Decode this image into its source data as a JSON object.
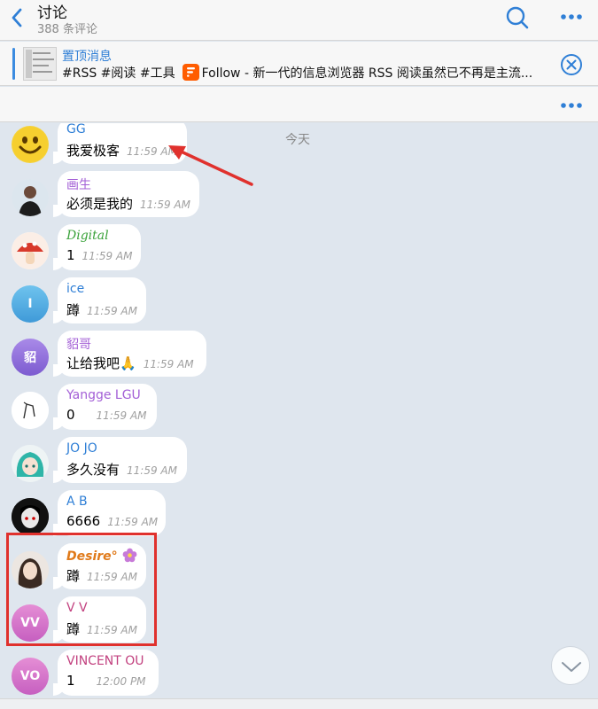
{
  "header": {
    "title": "讨论",
    "subtitle": "388 条评论",
    "icons": [
      "back-icon",
      "search-icon",
      "more-icon"
    ]
  },
  "pinned": {
    "label": "置顶消息",
    "tags": "#RSS #阅读 #工具",
    "follow_text": "Follow - 新一代的信息浏览器  RSS 阅读虽然已不再是主流...",
    "accent": "#2f7fd6"
  },
  "chat": {
    "date": "今天",
    "messages": [
      {
        "sender": "GG",
        "text": "我爱极客",
        "time": "11:59 AM",
        "sender_color": "#2f7fd6"
      },
      {
        "sender": "画生",
        "text": "必须是我的",
        "time": "11:59 AM",
        "sender_color": "#a35fd6"
      },
      {
        "sender": "Digital",
        "text": "1",
        "time": "11:59 AM",
        "sender_color": "#3aa23a"
      },
      {
        "sender": "ice",
        "text": "蹲",
        "time": "11:59 AM",
        "sender_color": "#2f7fd6",
        "avatar_letter": "I"
      },
      {
        "sender": "貂哥",
        "text": "让给我吧🙏",
        "time": "11:59 AM",
        "sender_color": "#a35fd6",
        "avatar_letter": "貂"
      },
      {
        "sender": "Yangge LGU",
        "text": "0",
        "time": "11:59 AM",
        "sender_color": "#a35fd6"
      },
      {
        "sender": "JO JO",
        "text": "多久没有",
        "time": "11:59 AM",
        "sender_color": "#2f7fd6"
      },
      {
        "sender": "A B",
        "text": "6666",
        "time": "11:59 AM",
        "sender_color": "#2f7fd6"
      },
      {
        "sender": "Desire°",
        "text": "蹲",
        "time": "11:59 AM",
        "sender_color": "#e07a1a"
      },
      {
        "sender": "V V",
        "text": "蹲",
        "time": "11:59 AM",
        "sender_color": "#c2417f",
        "avatar_letter": "VV"
      },
      {
        "sender": "VINCENT OU",
        "text": "1",
        "time": "12:00 PM",
        "sender_color": "#c2417f",
        "avatar_letter": "VO"
      }
    ]
  },
  "colors": {
    "annotation_red": "#e0312d",
    "chat_bg": "#dfe6ee"
  }
}
